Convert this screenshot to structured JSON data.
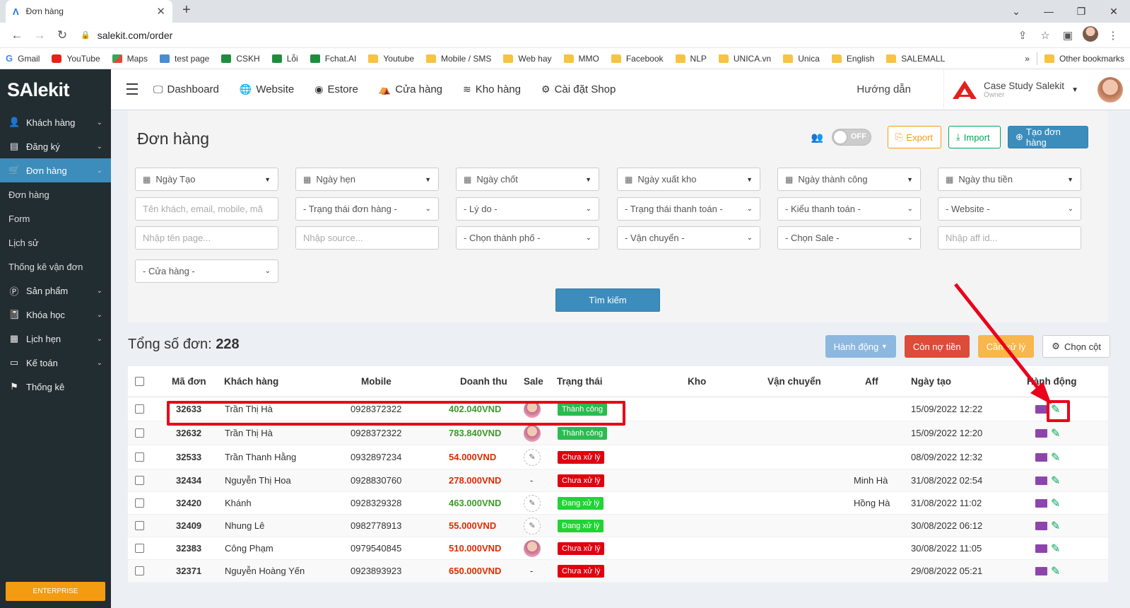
{
  "browser": {
    "tab_title": "Đơn hàng",
    "url": "salekit.com/order",
    "bookmarks": [
      {
        "label": "Gmail",
        "icon": "gmail-icon"
      },
      {
        "label": "YouTube",
        "icon": "youtube-icon"
      },
      {
        "label": "Maps",
        "icon": "maps-icon"
      },
      {
        "label": "test page",
        "icon": "page-icon"
      },
      {
        "label": "CSKH",
        "icon": "sheet-icon"
      },
      {
        "label": "Lỗi",
        "icon": "sheet-icon"
      },
      {
        "label": "Fchat.AI",
        "icon": "sheet-icon"
      },
      {
        "label": "Youtube",
        "icon": "folder-icon"
      },
      {
        "label": "Mobile / SMS",
        "icon": "folder-icon"
      },
      {
        "label": "Web hay",
        "icon": "folder-icon"
      },
      {
        "label": "MMO",
        "icon": "folder-icon"
      },
      {
        "label": "Facebook",
        "icon": "folder-icon"
      },
      {
        "label": "NLP",
        "icon": "folder-icon"
      },
      {
        "label": "UNICA.vn",
        "icon": "folder-icon"
      },
      {
        "label": "Unica",
        "icon": "folder-icon"
      },
      {
        "label": "English",
        "icon": "folder-icon"
      },
      {
        "label": "SALEMALL",
        "icon": "folder-icon"
      }
    ],
    "more": "»",
    "other_bookmarks": "Other bookmarks"
  },
  "sidebar": {
    "logo": "SAlekit",
    "items": [
      {
        "label": "Khách hàng",
        "icon": "user-icon",
        "expandable": true
      },
      {
        "label": "Đăng ký",
        "icon": "register-icon",
        "expandable": true
      },
      {
        "label": "Đơn hàng",
        "icon": "cart-icon",
        "expandable": true,
        "active": true
      }
    ],
    "subitems": [
      "Đơn hàng",
      "Form",
      "Lịch sử",
      "Thống kê vận đơn"
    ],
    "items2": [
      {
        "label": "Sản phẩm",
        "icon": "product-icon"
      },
      {
        "label": "Khóa học",
        "icon": "book-icon"
      },
      {
        "label": "Lịch hẹn",
        "icon": "calendar-icon"
      },
      {
        "label": "Kế toán",
        "icon": "card-icon"
      },
      {
        "label": "Thống kê",
        "icon": "flag-icon"
      }
    ],
    "enterprise": "ENTERPRISE"
  },
  "topnav": {
    "links": [
      {
        "label": "Dashboard",
        "icon": "monitor-icon"
      },
      {
        "label": "Website",
        "icon": "globe-icon"
      },
      {
        "label": "Estore",
        "icon": "compass-icon"
      },
      {
        "label": "Cửa hàng",
        "icon": "shop-icon"
      },
      {
        "label": "Kho hàng",
        "icon": "stack-icon"
      },
      {
        "label": "Cài đặt Shop",
        "icon": "gear-icon"
      }
    ],
    "guide": "Hướng dẫn",
    "account_name": "Case Study Salekit",
    "account_role": "Owner"
  },
  "page": {
    "title": "Đơn hàng",
    "toggle": "OFF",
    "export": "Export",
    "import": "Import",
    "create": "Tạo đơn hàng"
  },
  "filters": {
    "dates": [
      "Ngày Tạo",
      "Ngày hẹn",
      "Ngày chốt",
      "Ngày xuất kho",
      "Ngày thành công",
      "Ngày thu tiền"
    ],
    "search_placeholder": "Tên khách, email, mobile, mã",
    "selects1": [
      "- Trạng thái đơn hàng -",
      "- Lý do -",
      "- Trạng thái thanh toán -",
      "- Kiểu thanh toán -",
      "- Website -"
    ],
    "page_placeholder": "Nhập tên page...",
    "source_placeholder": "Nhập source...",
    "selects2": [
      "- Chọn thành phố -",
      "- Vận chuyển -",
      "- Chọn Sale -"
    ],
    "aff_placeholder": "Nhập aff id...",
    "store": "- Cửa hàng -",
    "search_button": "Tìm kiếm"
  },
  "summary": {
    "label": "Tổng số đơn:",
    "count": "228",
    "actions": "Hành động",
    "debt": "Còn nợ tiền",
    "handle": "Cần xử lý",
    "columns": "Chọn cột"
  },
  "table": {
    "headers": [
      "Mã đơn",
      "Khách hàng",
      "Mobile",
      "Doanh thu",
      "Sale",
      "Trạng thái",
      "Kho",
      "Vận chuyển",
      "Aff",
      "Ngày tạo",
      "Hành động"
    ],
    "rows": [
      {
        "id": "32633",
        "customer": "Trần Thị Hà",
        "mobile": "0928372322",
        "revenue": "402.040VND",
        "rev_color": "green",
        "sale": "photo",
        "status": "Thành công",
        "status_type": "ok",
        "aff": "",
        "created": "15/09/2022 12:22"
      },
      {
        "id": "32632",
        "customer": "Trần Thị Hà",
        "mobile": "0928372322",
        "revenue": "783.840VND",
        "rev_color": "green",
        "sale": "photo",
        "status": "Thành công",
        "status_type": "ok",
        "aff": "",
        "created": "15/09/2022 12:20"
      },
      {
        "id": "32533",
        "customer": "Trần Thanh Hằng",
        "mobile": "0932897234",
        "revenue": "54.000VND",
        "rev_color": "red",
        "sale": "sketch",
        "status": "Chưa xử lý",
        "status_type": "red",
        "aff": "",
        "created": "08/09/2022 12:32"
      },
      {
        "id": "32434",
        "customer": "Nguyễn Thị Hoa",
        "mobile": "0928830760",
        "revenue": "278.000VND",
        "rev_color": "red",
        "sale": "-",
        "status": "Chưa xử lý",
        "status_type": "red",
        "aff": "Minh Hà",
        "created": "31/08/2022 02:54"
      },
      {
        "id": "32420",
        "customer": "Khánh",
        "mobile": "0928329328",
        "revenue": "463.000VND",
        "rev_color": "green",
        "sale": "sketch",
        "status": "Đang xử lý",
        "status_type": "green",
        "aff": "Hồng Hà",
        "created": "31/08/2022 11:02"
      },
      {
        "id": "32409",
        "customer": "Nhung Lê",
        "mobile": "0982778913",
        "revenue": "55.000VND",
        "rev_color": "red",
        "sale": "sketch",
        "status": "Đang xử lý",
        "status_type": "green",
        "aff": "",
        "created": "30/08/2022 06:12"
      },
      {
        "id": "32383",
        "customer": "Công Phạm",
        "mobile": "0979540845",
        "revenue": "510.000VND",
        "rev_color": "red",
        "sale": "photo",
        "status": "Chưa xử lý",
        "status_type": "red",
        "aff": "",
        "created": "30/08/2022 11:05"
      },
      {
        "id": "32371",
        "customer": "Nguyễn Hoàng Yến",
        "mobile": "0923893923",
        "revenue": "650.000VND",
        "rev_color": "red",
        "sale": "-",
        "status": "Chưa xử lý",
        "status_type": "red",
        "aff": "",
        "created": "29/08/2022 05:21"
      }
    ]
  },
  "colors": {
    "sidebar": "#222d32",
    "accent": "#3c8dbc",
    "highlight": "#e9001a"
  }
}
